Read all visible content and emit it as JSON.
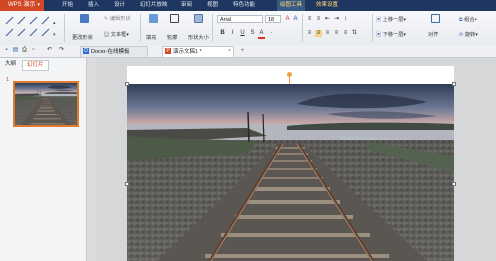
{
  "app": {
    "name": "WPS 演示",
    "brand_color": "#d24726"
  },
  "menu": [
    {
      "label": "开始"
    },
    {
      "label": "插入"
    },
    {
      "label": "设计"
    },
    {
      "label": "幻灯片放映"
    },
    {
      "label": "审阅"
    },
    {
      "label": "视图"
    },
    {
      "label": "特色功能"
    },
    {
      "label": "绘图工具"
    },
    {
      "label": "效果设置"
    }
  ],
  "ribbon": {
    "change_shape": "更改形状",
    "text_box": "文本框",
    "edit_shape": "编辑形状",
    "fill": "填充",
    "outline": "轮廓",
    "shape_size": "形状大小",
    "font": "Arial",
    "font_size": "18",
    "bring_forward": "上移一层",
    "send_backward": "下移一层",
    "align": "对齐",
    "group": "组合",
    "rotate": "旋转",
    "bold": "B",
    "italic": "I",
    "underline": "U",
    "font_color_glyph": "A"
  },
  "tabs": [
    {
      "label": "Docer-在线模板"
    },
    {
      "label": "演示文稿1 *"
    }
  ],
  "panel_tabs": [
    {
      "label": "大纲"
    },
    {
      "label": "幻灯片"
    }
  ],
  "slide_thumb": {
    "number": "1"
  },
  "icons": [
    "save-icon",
    "undo-icon",
    "redo-icon",
    "print-icon",
    "doc-icon",
    "close-icon",
    "rotate-handle-icon"
  ]
}
